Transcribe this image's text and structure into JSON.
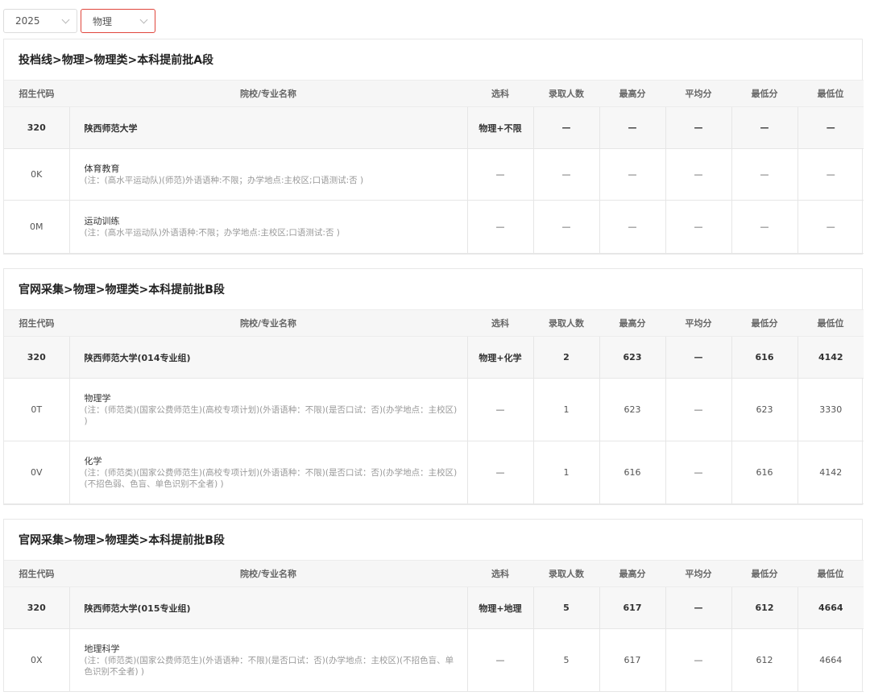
{
  "filters": {
    "year": "2025",
    "subject": "物理"
  },
  "headers": [
    "招生代码",
    "院校/专业名称",
    "选科",
    "录取人数",
    "最高分",
    "平均分",
    "最低分",
    "最低位"
  ],
  "sections": [
    {
      "title": "投档线>物理>物理类>本科提前批A段",
      "group": {
        "code": "320",
        "name": "陕西师范大学",
        "subject": "物理+不限",
        "count": "—",
        "max": "—",
        "avg": "—",
        "min": "—",
        "rank": "—"
      },
      "rows": [
        {
          "code": "0K",
          "major": "体育教育",
          "note": "(注：(高水平运动队)(师范)外语语种:不限；办学地点:主校区;口语测试:否 )",
          "subject": "—",
          "count": "—",
          "max": "—",
          "avg": "—",
          "min": "—",
          "rank": "—"
        },
        {
          "code": "0M",
          "major": "运动训练",
          "note": "(注：(高水平运动队)外语语种:不限；办学地点:主校区;口语测试:否 )",
          "subject": "—",
          "count": "—",
          "max": "—",
          "avg": "—",
          "min": "—",
          "rank": "—"
        }
      ]
    },
    {
      "title": "官网采集>物理>物理类>本科提前批B段",
      "group": {
        "code": "320",
        "name": "陕西师范大学(014专业组)",
        "subject": "物理+化学",
        "count": "2",
        "max": "623",
        "avg": "—",
        "min": "616",
        "rank": "4142"
      },
      "rows": [
        {
          "code": "0T",
          "major": "物理学",
          "note": "(注：(师范类)(国家公费师范生)(高校专项计划)(外语语种：不限)(是否口试：否)(办学地点：主校区) )",
          "subject": "—",
          "count": "1",
          "max": "623",
          "avg": "—",
          "min": "623",
          "rank": "3330"
        },
        {
          "code": "0V",
          "major": "化学",
          "note": "(注：(师范类)(国家公费师范生)(高校专项计划)(外语语种：不限)(是否口试：否)(办学地点：主校区)(不招色弱、色盲、单色识别不全者) )",
          "subject": "—",
          "count": "1",
          "max": "616",
          "avg": "—",
          "min": "616",
          "rank": "4142"
        }
      ]
    },
    {
      "title": "官网采集>物理>物理类>本科提前批B段",
      "group": {
        "code": "320",
        "name": "陕西师范大学(015专业组)",
        "subject": "物理+地理",
        "count": "5",
        "max": "617",
        "avg": "—",
        "min": "612",
        "rank": "4664"
      },
      "rows": [
        {
          "code": "0X",
          "major": "地理科学",
          "note": "(注：(师范类)(国家公费师范生)(外语语种：不限)(是否口试：否)(办学地点：主校区)(不招色盲、单色识别不全者) )",
          "subject": "—",
          "count": "5",
          "max": "617",
          "avg": "—",
          "min": "612",
          "rank": "4664"
        }
      ]
    }
  ]
}
